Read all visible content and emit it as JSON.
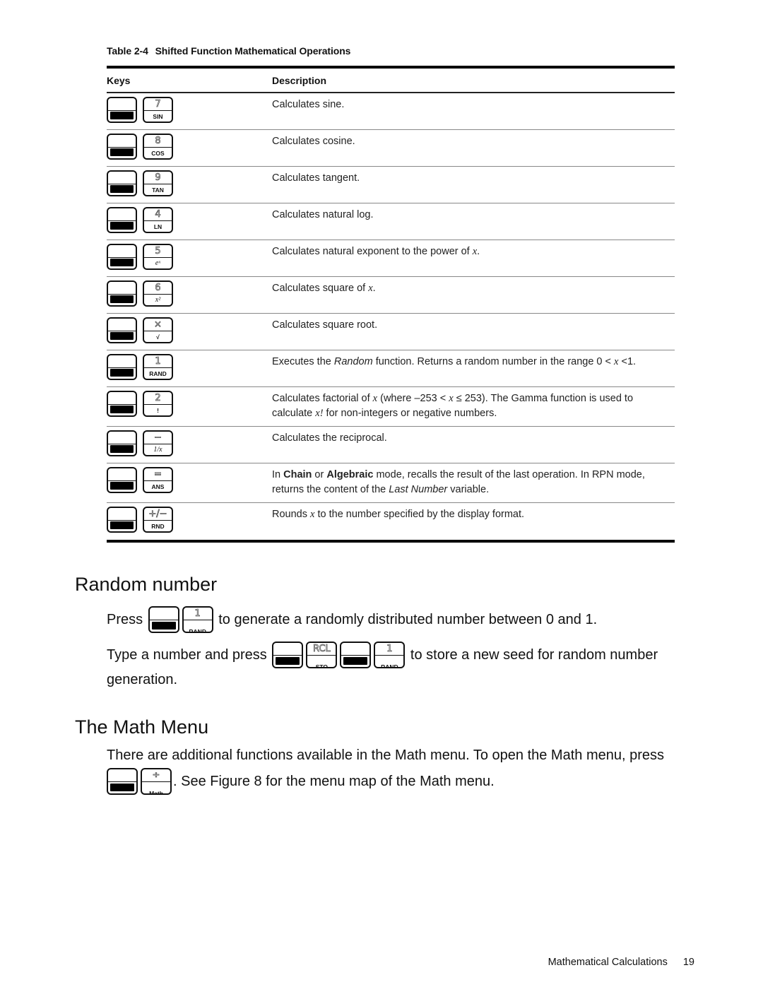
{
  "table": {
    "number": "Table 2-4",
    "title": "Shifted Function Mathematical Operations",
    "headers": {
      "keys": "Keys",
      "description": "Description"
    },
    "rows": [
      {
        "key_top": "7",
        "key_bottom": "SIN",
        "description": "Calculates sine."
      },
      {
        "key_top": "8",
        "key_bottom": "COS",
        "description": "Calculates cosine."
      },
      {
        "key_top": "9",
        "key_bottom": "TAN",
        "description": "Calculates tangent."
      },
      {
        "key_top": "4",
        "key_bottom": "LN",
        "description": "Calculates natural log."
      },
      {
        "key_top": "5",
        "key_bottom": "eˣ",
        "description_parts": [
          "Calculates natural exponent to the power of ",
          "x",
          "."
        ]
      },
      {
        "key_top": "6",
        "key_bottom": "x²",
        "description_parts": [
          "Calculates square of ",
          "x",
          "."
        ]
      },
      {
        "key_top": "×",
        "key_bottom": "√",
        "description": "Calculates square root."
      },
      {
        "key_top": "1",
        "key_bottom": "RAND",
        "description_parts": [
          "Executes the ",
          "Random",
          " function. Returns a random number in the range 0 < ",
          "x",
          " <1."
        ]
      },
      {
        "key_top": "2",
        "key_bottom": "!",
        "description_parts": [
          "Calculates factorial of ",
          "x",
          " (where –253 < ",
          "x",
          " ≤ 253). The Gamma function is used to calculate ",
          "x!",
          " for non-integers or negative numbers."
        ]
      },
      {
        "key_top": "−",
        "key_bottom": "1/x",
        "description": "Calculates the reciprocal."
      },
      {
        "key_top": "=",
        "key_bottom": "ANS",
        "description_parts": [
          "In ",
          "Chain",
          " or ",
          "Algebraic",
          " mode, recalls the result of the last operation. In RPN mode, returns the content of the ",
          "Last Number",
          " variable."
        ]
      },
      {
        "key_top": "+/−",
        "key_bottom": "RND",
        "description_parts": [
          "Rounds ",
          "x",
          " to the number specified by the display format."
        ]
      }
    ]
  },
  "random_section": {
    "title": "Random number",
    "line1_prefix": "Press",
    "line1_suffix": "to generate a randomly distributed number between 0 and 1.",
    "line2_prefix": "Type a number and press",
    "line2_suffix": "to store a new seed for random number",
    "line2_cont": "generation.",
    "keys": {
      "rand_top": "1",
      "rand_bottom": "RAND",
      "sto_top": "RCL",
      "sto_bottom": "STO"
    }
  },
  "math_section": {
    "title": "The Math Menu",
    "line1": "There are additional functions available in the Math menu. To open the Math menu, press",
    "line2_suffix": ". See Figure 8 for the menu map of the Math menu.",
    "keys": {
      "math_top": "÷",
      "math_bottom": "Math"
    }
  },
  "footer": {
    "section": "Mathematical Calculations",
    "page": "19"
  }
}
